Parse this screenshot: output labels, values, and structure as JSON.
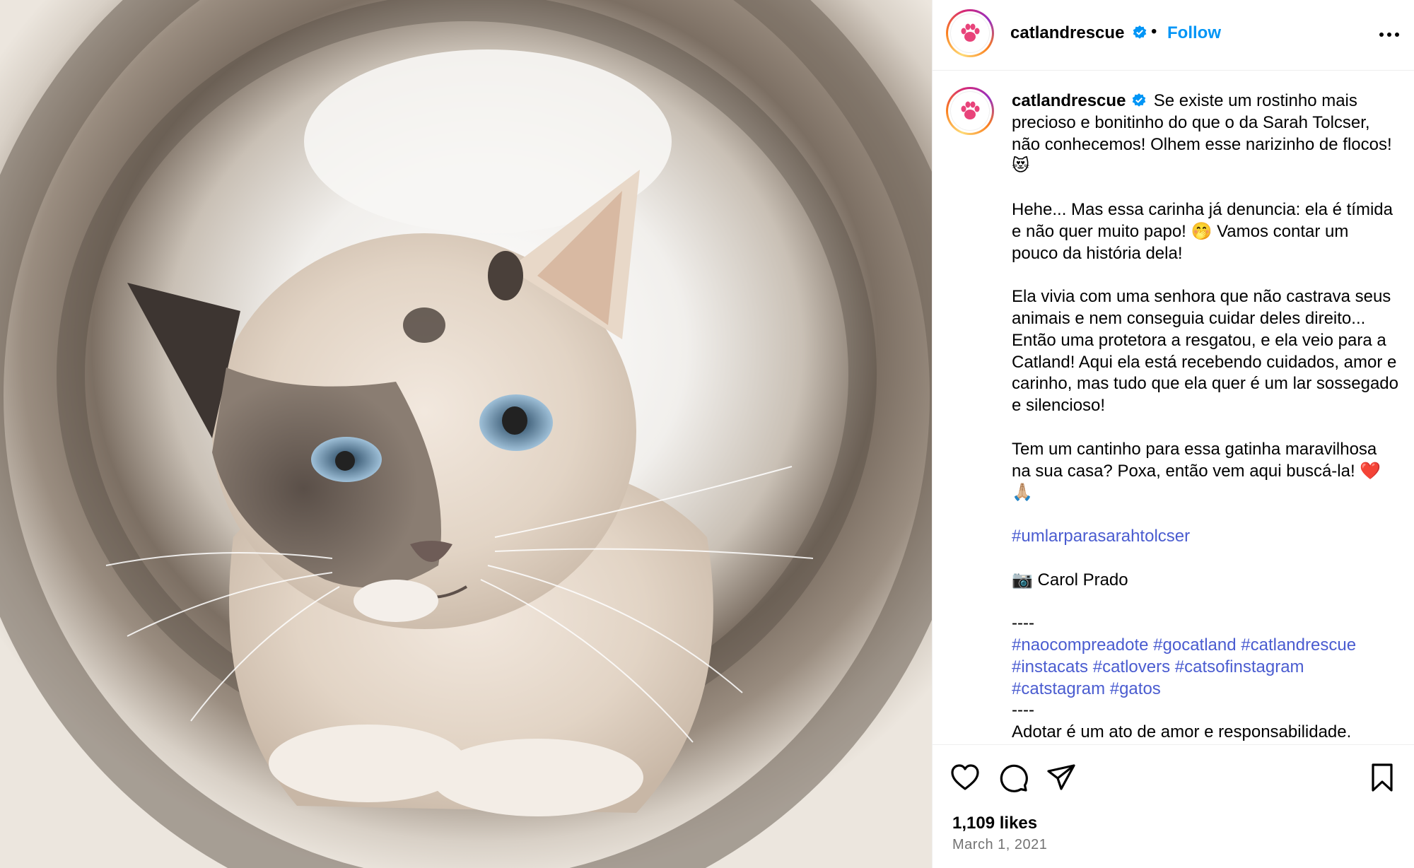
{
  "post": {
    "image_alt": "Siamese mix cat peeking through a carpeted tunnel",
    "username": "catlandrescue",
    "follow_label": "Follow",
    "separator": "•",
    "caption": {
      "username": "catlandrescue",
      "p1": "Se existe um rostinho mais precioso e bonitinho do que o da Sarah Tolcser, não conhecemos! Olhem esse narizinho de flocos! 😻",
      "p2": "Hehe... Mas essa carinha já denuncia: ela é tímida e não quer muito papo! 🤭 Vamos contar um pouco da história dela!",
      "p3": "Ela vivia com uma senhora que não castrava seus animais e nem conseguia cuidar deles direito... Então uma protetora a resgatou, e ela veio para a Catland! Aqui ela está recebendo cuidados, amor e carinho, mas tudo que ela quer é um lar sossegado e silencioso!",
      "p4": "Tem um cantinho para essa gatinha maravilhosa na sua casa? Poxa, então vem aqui buscá-la! ❤️🙏🏼",
      "hashtag_main": "#umlarparasarahtolcser",
      "photo_credit": "📷 Carol Prado",
      "divider": "----",
      "hashtags": [
        "#naocompreadote",
        "#gocatland",
        "#catlandrescue",
        "#instacats",
        "#catlovers",
        "#catsofinstagram",
        "#catstagram",
        "#gatos"
      ],
      "divider2": "----",
      "closing": "Adotar é um ato de amor e responsabilidade."
    },
    "likes": "1,109 likes",
    "date": "March 1, 2021"
  },
  "colors": {
    "link": "#4a5cd0",
    "follow": "#0095f6",
    "verified": "#0095f6",
    "paw": "#e8437a"
  },
  "icons": [
    "paw-icon",
    "verified-icon",
    "more-icon",
    "heart-icon",
    "comment-icon",
    "share-icon",
    "bookmark-icon"
  ]
}
